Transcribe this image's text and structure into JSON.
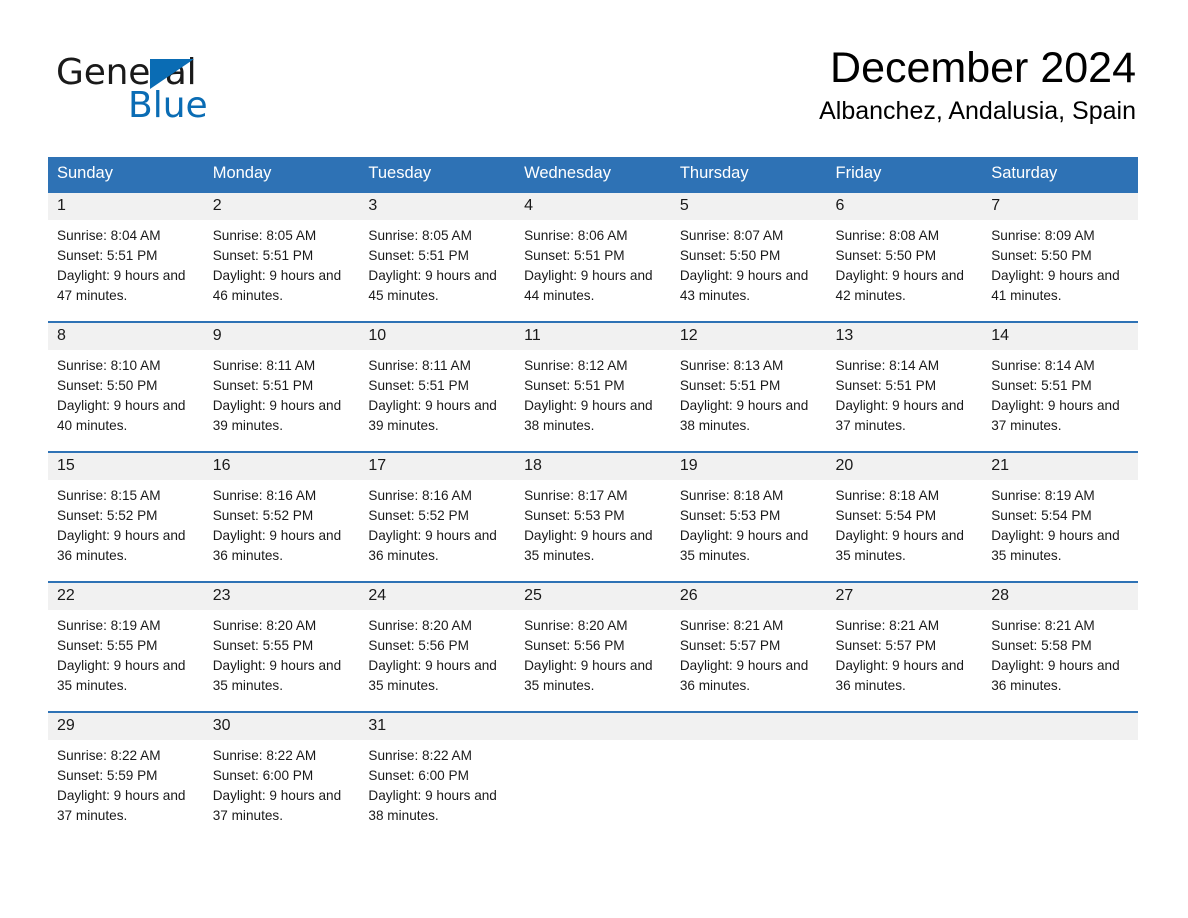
{
  "brand": {
    "name_part1": "General",
    "name_part2": "Blue",
    "triangle_icon": "triangle-icon",
    "accent_color": "#0a6cb4"
  },
  "header": {
    "month_title": "December 2024",
    "location": "Albanchez, Andalusia, Spain"
  },
  "theme": {
    "header_blue": "#2e72b5",
    "row_band_gray": "#f1f1f1",
    "text_color": "#1a1a1a"
  },
  "weekdays": [
    "Sunday",
    "Monday",
    "Tuesday",
    "Wednesday",
    "Thursday",
    "Friday",
    "Saturday"
  ],
  "weeks": [
    [
      {
        "day": "1",
        "sunrise": "Sunrise: 8:04 AM",
        "sunset": "Sunset: 5:51 PM",
        "daylight": "Daylight: 9 hours and 47 minutes."
      },
      {
        "day": "2",
        "sunrise": "Sunrise: 8:05 AM",
        "sunset": "Sunset: 5:51 PM",
        "daylight": "Daylight: 9 hours and 46 minutes."
      },
      {
        "day": "3",
        "sunrise": "Sunrise: 8:05 AM",
        "sunset": "Sunset: 5:51 PM",
        "daylight": "Daylight: 9 hours and 45 minutes."
      },
      {
        "day": "4",
        "sunrise": "Sunrise: 8:06 AM",
        "sunset": "Sunset: 5:51 PM",
        "daylight": "Daylight: 9 hours and 44 minutes."
      },
      {
        "day": "5",
        "sunrise": "Sunrise: 8:07 AM",
        "sunset": "Sunset: 5:50 PM",
        "daylight": "Daylight: 9 hours and 43 minutes."
      },
      {
        "day": "6",
        "sunrise": "Sunrise: 8:08 AM",
        "sunset": "Sunset: 5:50 PM",
        "daylight": "Daylight: 9 hours and 42 minutes."
      },
      {
        "day": "7",
        "sunrise": "Sunrise: 8:09 AM",
        "sunset": "Sunset: 5:50 PM",
        "daylight": "Daylight: 9 hours and 41 minutes."
      }
    ],
    [
      {
        "day": "8",
        "sunrise": "Sunrise: 8:10 AM",
        "sunset": "Sunset: 5:50 PM",
        "daylight": "Daylight: 9 hours and 40 minutes."
      },
      {
        "day": "9",
        "sunrise": "Sunrise: 8:11 AM",
        "sunset": "Sunset: 5:51 PM",
        "daylight": "Daylight: 9 hours and 39 minutes."
      },
      {
        "day": "10",
        "sunrise": "Sunrise: 8:11 AM",
        "sunset": "Sunset: 5:51 PM",
        "daylight": "Daylight: 9 hours and 39 minutes."
      },
      {
        "day": "11",
        "sunrise": "Sunrise: 8:12 AM",
        "sunset": "Sunset: 5:51 PM",
        "daylight": "Daylight: 9 hours and 38 minutes."
      },
      {
        "day": "12",
        "sunrise": "Sunrise: 8:13 AM",
        "sunset": "Sunset: 5:51 PM",
        "daylight": "Daylight: 9 hours and 38 minutes."
      },
      {
        "day": "13",
        "sunrise": "Sunrise: 8:14 AM",
        "sunset": "Sunset: 5:51 PM",
        "daylight": "Daylight: 9 hours and 37 minutes."
      },
      {
        "day": "14",
        "sunrise": "Sunrise: 8:14 AM",
        "sunset": "Sunset: 5:51 PM",
        "daylight": "Daylight: 9 hours and 37 minutes."
      }
    ],
    [
      {
        "day": "15",
        "sunrise": "Sunrise: 8:15 AM",
        "sunset": "Sunset: 5:52 PM",
        "daylight": "Daylight: 9 hours and 36 minutes."
      },
      {
        "day": "16",
        "sunrise": "Sunrise: 8:16 AM",
        "sunset": "Sunset: 5:52 PM",
        "daylight": "Daylight: 9 hours and 36 minutes."
      },
      {
        "day": "17",
        "sunrise": "Sunrise: 8:16 AM",
        "sunset": "Sunset: 5:52 PM",
        "daylight": "Daylight: 9 hours and 36 minutes."
      },
      {
        "day": "18",
        "sunrise": "Sunrise: 8:17 AM",
        "sunset": "Sunset: 5:53 PM",
        "daylight": "Daylight: 9 hours and 35 minutes."
      },
      {
        "day": "19",
        "sunrise": "Sunrise: 8:18 AM",
        "sunset": "Sunset: 5:53 PM",
        "daylight": "Daylight: 9 hours and 35 minutes."
      },
      {
        "day": "20",
        "sunrise": "Sunrise: 8:18 AM",
        "sunset": "Sunset: 5:54 PM",
        "daylight": "Daylight: 9 hours and 35 minutes."
      },
      {
        "day": "21",
        "sunrise": "Sunrise: 8:19 AM",
        "sunset": "Sunset: 5:54 PM",
        "daylight": "Daylight: 9 hours and 35 minutes."
      }
    ],
    [
      {
        "day": "22",
        "sunrise": "Sunrise: 8:19 AM",
        "sunset": "Sunset: 5:55 PM",
        "daylight": "Daylight: 9 hours and 35 minutes."
      },
      {
        "day": "23",
        "sunrise": "Sunrise: 8:20 AM",
        "sunset": "Sunset: 5:55 PM",
        "daylight": "Daylight: 9 hours and 35 minutes."
      },
      {
        "day": "24",
        "sunrise": "Sunrise: 8:20 AM",
        "sunset": "Sunset: 5:56 PM",
        "daylight": "Daylight: 9 hours and 35 minutes."
      },
      {
        "day": "25",
        "sunrise": "Sunrise: 8:20 AM",
        "sunset": "Sunset: 5:56 PM",
        "daylight": "Daylight: 9 hours and 35 minutes."
      },
      {
        "day": "26",
        "sunrise": "Sunrise: 8:21 AM",
        "sunset": "Sunset: 5:57 PM",
        "daylight": "Daylight: 9 hours and 36 minutes."
      },
      {
        "day": "27",
        "sunrise": "Sunrise: 8:21 AM",
        "sunset": "Sunset: 5:57 PM",
        "daylight": "Daylight: 9 hours and 36 minutes."
      },
      {
        "day": "28",
        "sunrise": "Sunrise: 8:21 AM",
        "sunset": "Sunset: 5:58 PM",
        "daylight": "Daylight: 9 hours and 36 minutes."
      }
    ],
    [
      {
        "day": "29",
        "sunrise": "Sunrise: 8:22 AM",
        "sunset": "Sunset: 5:59 PM",
        "daylight": "Daylight: 9 hours and 37 minutes."
      },
      {
        "day": "30",
        "sunrise": "Sunrise: 8:22 AM",
        "sunset": "Sunset: 6:00 PM",
        "daylight": "Daylight: 9 hours and 37 minutes."
      },
      {
        "day": "31",
        "sunrise": "Sunrise: 8:22 AM",
        "sunset": "Sunset: 6:00 PM",
        "daylight": "Daylight: 9 hours and 38 minutes."
      },
      {
        "day": "",
        "sunrise": "",
        "sunset": "",
        "daylight": ""
      },
      {
        "day": "",
        "sunrise": "",
        "sunset": "",
        "daylight": ""
      },
      {
        "day": "",
        "sunrise": "",
        "sunset": "",
        "daylight": ""
      },
      {
        "day": "",
        "sunrise": "",
        "sunset": "",
        "daylight": ""
      }
    ]
  ]
}
